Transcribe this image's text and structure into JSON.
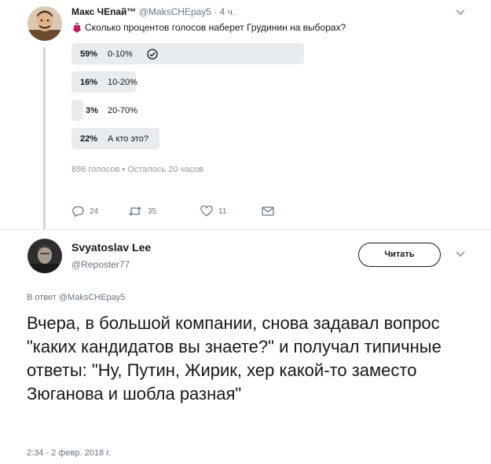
{
  "tweet1": {
    "author_name": "Макс ЧЕпай™",
    "author_handle": "@MaksCHEpay5",
    "dot": "·",
    "time": "4 ч.",
    "text": "Сколько процентов голосов наберет Грудинин на выборах?",
    "poll": {
      "options": [
        {
          "percent_label": "59%",
          "label": "0-10%",
          "value": 59,
          "chosen": true
        },
        {
          "percent_label": "16%",
          "label": "10-20%",
          "value": 16,
          "chosen": false
        },
        {
          "percent_label": "3%",
          "label": "20-70%",
          "value": 3,
          "chosen": false
        },
        {
          "percent_label": "22%",
          "label": "А кто это?",
          "value": 22,
          "chosen": false
        }
      ],
      "meta": "896 голосов • Осталось 20 часов"
    },
    "actions": {
      "replies": "24",
      "retweets": "35",
      "likes": "11"
    }
  },
  "tweet2": {
    "author_name": "Svyatoslav Lee",
    "author_handle": "@Reposter77",
    "follow_label": "Читать",
    "reply_prefix": "В ответ",
    "reply_mention": "@MaksCHEpay5",
    "text": "Вчера, в большой компании, снова задавал вопрос \"каких кандидатов вы знаете?\" и получал типичные ответы: \"Ну, Путин, Жирик, хер какой-то заместо Зюганова и шобла разная\"",
    "date": "2:34 - 2 февр. 2018 г."
  },
  "colors": {
    "poll_bar": "#e8ecef",
    "secondary_text": "#657786",
    "thread_line": "#ccd6dd"
  },
  "icons": [
    "avatar",
    "caret-down-icon",
    "raspberry-emoji-icon",
    "check-circle-icon",
    "reply-icon",
    "retweet-icon",
    "like-icon",
    "message-icon"
  ]
}
